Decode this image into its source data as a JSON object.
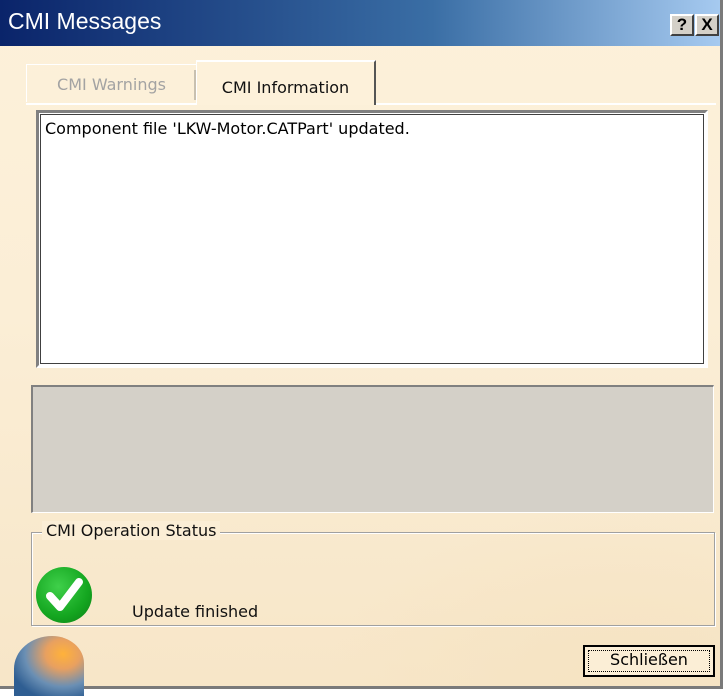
{
  "window": {
    "title": "CMI Messages",
    "help_button": "?",
    "close_button": "X"
  },
  "tabs": [
    {
      "label": "CMI Warnings",
      "active": false
    },
    {
      "label": "CMI Information",
      "active": true
    }
  ],
  "messages": [
    "Component file 'LKW-Motor.CATPart' updated."
  ],
  "status_group": {
    "label": "CMI Operation Status",
    "icon": "success-check-icon",
    "text": "Update finished"
  },
  "close_label": "Schließen",
  "colors": {
    "title_gradient_start": "#0a246a",
    "title_gradient_end": "#a6caf0",
    "background": "#fbeed6",
    "success": "#14a620"
  }
}
